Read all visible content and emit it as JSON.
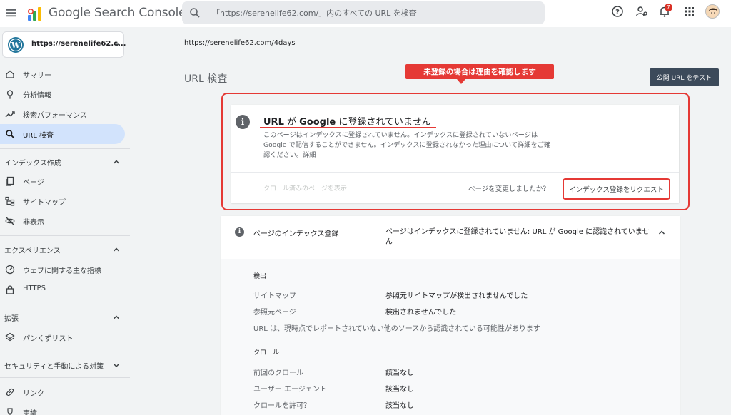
{
  "header": {
    "app_title": "Google Search Console",
    "search_placeholder": "「https://serenelife62.com/」内のすべての URL を検査",
    "notification_count": "7",
    "colors": {
      "header_bg": "#ffffff",
      "accent_red": "#e53935"
    }
  },
  "sidebar": {
    "property_label": "https://serenelife62.c...",
    "items": [
      {
        "label": "サマリー",
        "icon": "home-icon"
      },
      {
        "label": "分析情報",
        "icon": "lightbulb-icon"
      },
      {
        "label": "検索パフォーマンス",
        "icon": "trending-up-icon"
      },
      {
        "label": "URL 検査",
        "icon": "search-icon",
        "active": true
      }
    ],
    "sections": [
      {
        "label": "インデックス作成",
        "items": [
          {
            "label": "ページ",
            "icon": "pages-icon"
          },
          {
            "label": "サイトマップ",
            "icon": "sitemap-icon"
          },
          {
            "label": "非表示",
            "icon": "eye-off-icon"
          }
        ]
      },
      {
        "label": "エクスペリエンス",
        "items": [
          {
            "label": "ウェブに関する主な指標",
            "icon": "gauge-icon"
          },
          {
            "label": "HTTPS",
            "icon": "lock-icon"
          }
        ]
      },
      {
        "label": "拡張",
        "items": [
          {
            "label": "パンくずリスト",
            "icon": "layers-icon"
          }
        ]
      },
      {
        "label": "セキュリティと手動による対策",
        "items": []
      }
    ],
    "bottom_items": [
      {
        "label": "リンク",
        "icon": "link-icon"
      },
      {
        "label": "実績",
        "icon": "trophy-icon"
      }
    ]
  },
  "main": {
    "url": "https://serenelife62.com/4days",
    "page_title": "URL 検査",
    "test_button": "公開 URL をテスト",
    "callout": "未登録の場合は理由を確認します",
    "status_card": {
      "title_a": "URL",
      "title_b": " が ",
      "title_c": "Google",
      "title_d": " に登録されていません",
      "description": "このページはインデックスに登録されていません。インデックスに登録されていないページは Google で配信することができません。インデックスに登録されなかった理由について詳細をご確認ください。",
      "detail_link": "詳細",
      "crawled_page_link": "クロール済みのページを表示",
      "changed_question": "ページを変更しましたか？",
      "request_button": "インデックス登録をリクエスト"
    },
    "index_card": {
      "label": "ページのインデックス登録",
      "value": "ページはインデックスに登録されていません: URL が Google に認識されていません",
      "discovery": {
        "heading": "検出",
        "rows": [
          {
            "key": "サイトマップ",
            "value": "参照元サイトマップが検出されませんでした"
          },
          {
            "key": "参照元ページ",
            "value": "検出されませんでした"
          }
        ],
        "note": "URL は、現時点でレポートされていない他のソースから認識されている可能性があります"
      },
      "crawl": {
        "heading": "クロール",
        "rows": [
          {
            "key": "前回のクロール",
            "value": "該当なし"
          },
          {
            "key": "ユーザー エージェント",
            "value": "該当なし"
          },
          {
            "key": "クロールを許可？",
            "value": "該当なし"
          }
        ]
      }
    }
  }
}
